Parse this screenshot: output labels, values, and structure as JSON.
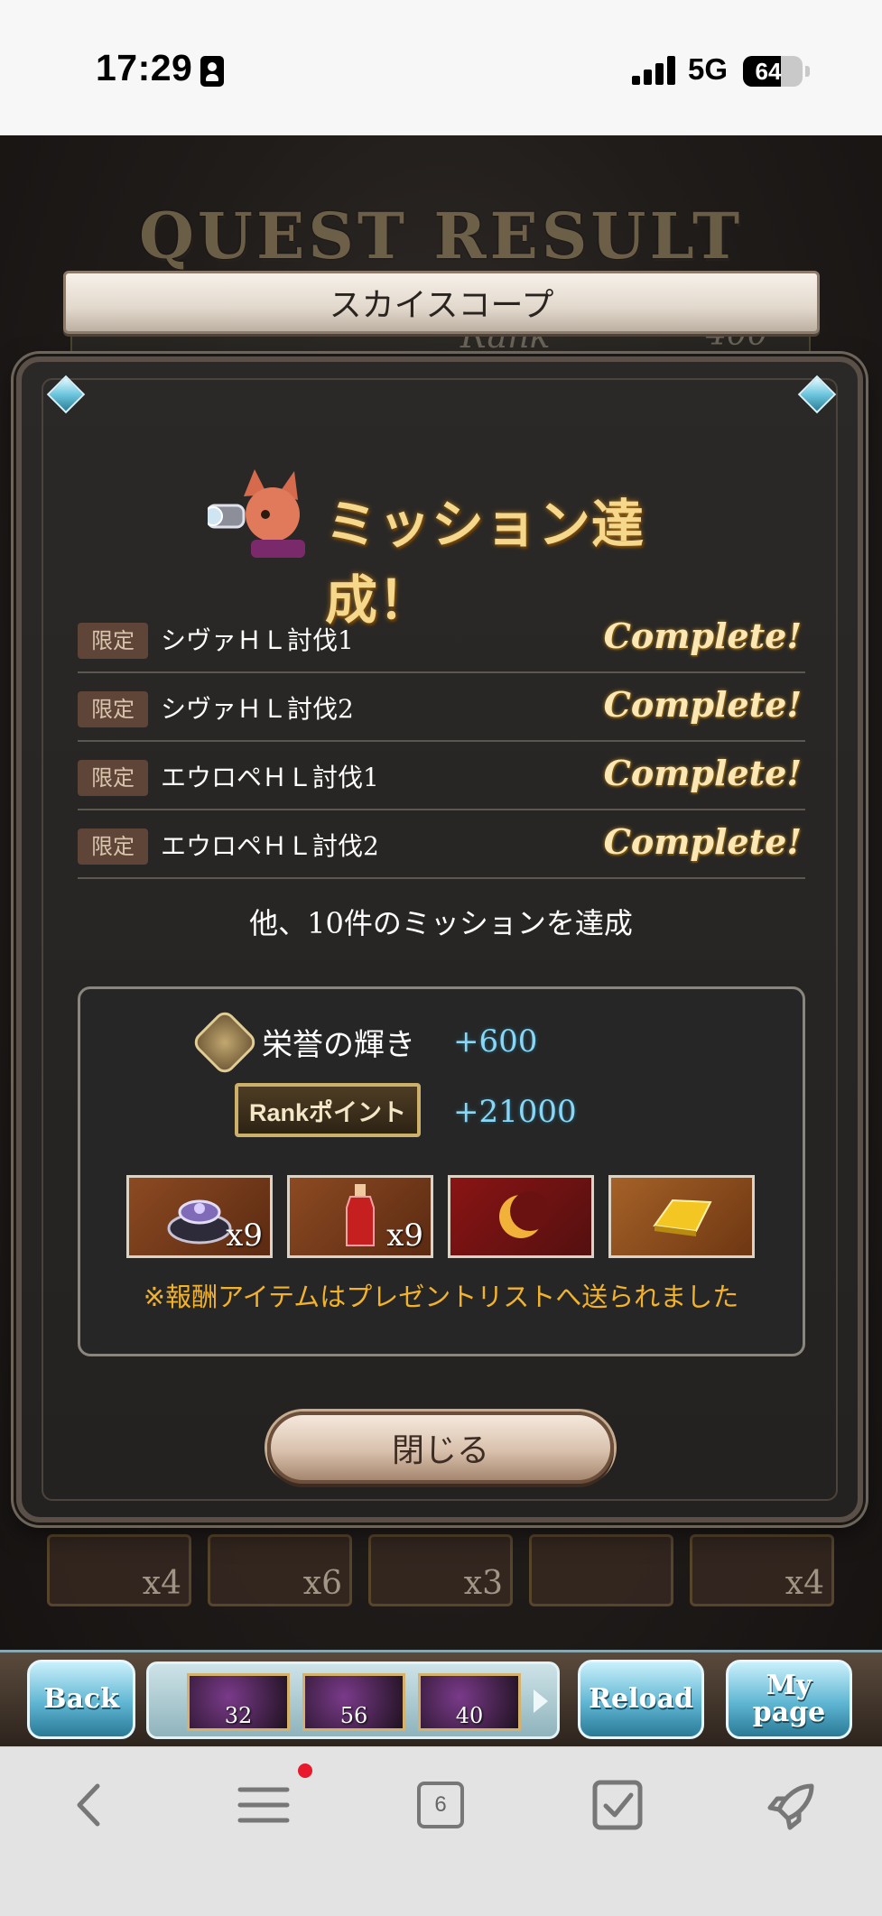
{
  "status_bar": {
    "time": "17:29",
    "network": "5G",
    "battery_level": "64",
    "battery_fraction": 0.64
  },
  "background": {
    "title": "QUEST RESULT",
    "rank_label": "Rank",
    "rank_value": "400",
    "tiles": [
      {
        "count": "x4"
      },
      {
        "count": "x6"
      },
      {
        "count": "x3"
      },
      {
        "count": ""
      },
      {
        "count": "x4"
      }
    ]
  },
  "modal": {
    "title": "スカイスコープ",
    "banner": "ミッション達成！",
    "missions": [
      {
        "badge": "限定",
        "name": "シヴァＨＬ討伐1",
        "status": "Complete!"
      },
      {
        "badge": "限定",
        "name": "シヴァＨＬ討伐2",
        "status": "Complete!"
      },
      {
        "badge": "限定",
        "name": "エウロペＨＬ討伐1",
        "status": "Complete!"
      },
      {
        "badge": "限定",
        "name": "エウロペＨＬ討伐2",
        "status": "Complete!"
      }
    ],
    "more_text": "他、10件のミッションを達成",
    "rewards": {
      "honor_label": "栄誉の輝き",
      "honor_value": "+600",
      "rank_point_label": "Rankポイント",
      "rank_point_value": "+21000",
      "items": [
        {
          "name": "ring-box",
          "count": "x9",
          "style": "orange"
        },
        {
          "name": "potion",
          "count": "x9",
          "style": "orange"
        },
        {
          "name": "crescent-moon",
          "count": "",
          "style": "red"
        },
        {
          "name": "gold-bar",
          "count": "",
          "style": "gold"
        }
      ],
      "notice": "※報酬アイテムはプレゼントリストへ送られました"
    },
    "close_button": "閉じる"
  },
  "game_nav": {
    "back": "Back",
    "reload": "Reload",
    "mypage_line1": "My",
    "mypage_line2": "page",
    "items": [
      {
        "name": "item-1",
        "count": "32"
      },
      {
        "name": "item-2",
        "count": "56"
      },
      {
        "name": "item-3",
        "count": "40"
      }
    ]
  },
  "browser_toolbar": {
    "tab_count": "6"
  },
  "colors": {
    "accent_blue": "#8ad7f5",
    "notice_orange": "#f2b22b",
    "complete_gold": "#fbe7b4"
  }
}
